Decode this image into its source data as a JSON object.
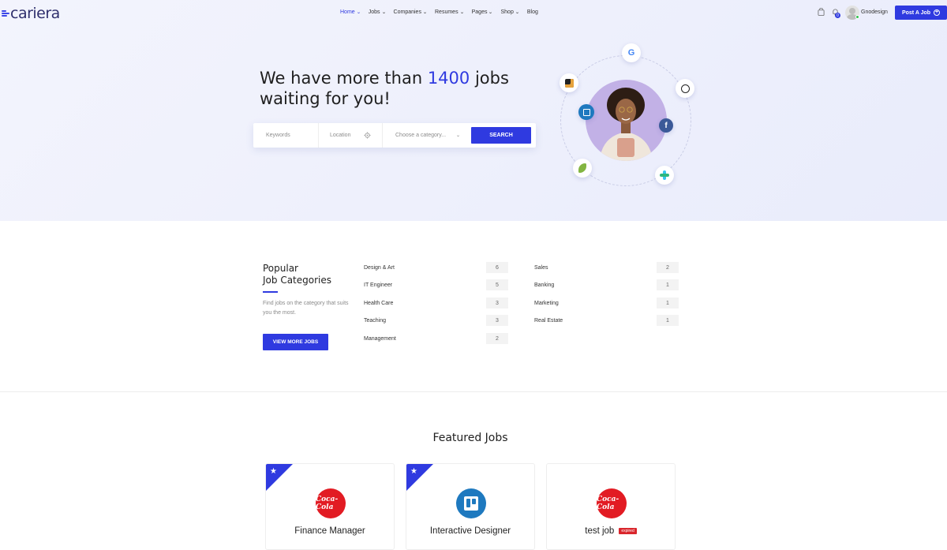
{
  "header": {
    "logo": "cariera",
    "nav": [
      {
        "label": "Home",
        "dropdown": true,
        "active": true
      },
      {
        "label": "Jobs",
        "dropdown": true
      },
      {
        "label": "Companies",
        "dropdown": true
      },
      {
        "label": "Resumes",
        "dropdown": true
      },
      {
        "label": "Pages",
        "dropdown": true
      },
      {
        "label": "Shop",
        "dropdown": true
      },
      {
        "label": "Blog",
        "dropdown": false
      }
    ],
    "notification_count": "0",
    "username": "Gnodesign",
    "post_job_label": "Post A Job"
  },
  "hero": {
    "title_prefix": "We have more than",
    "title_number": "1400",
    "title_suffix": "jobs",
    "title_line2": "waiting for you!",
    "keywords_placeholder": "Keywords",
    "location_placeholder": "Location",
    "category_placeholder": "Choose a category...",
    "search_label": "SEARCH",
    "company_badges": [
      "google-icon",
      "squarespace-icon",
      "github-icon",
      "trello-icon",
      "facebook-icon",
      "envato-icon",
      "slack-icon"
    ]
  },
  "categories": {
    "title_line1": "Popular",
    "title_line2": "Job Categories",
    "description": "Find jobs on the category that suits you the most.",
    "view_more_label": "VIEW MORE JOBS",
    "left": [
      {
        "name": "Design & Art",
        "count": "6"
      },
      {
        "name": "IT Engineer",
        "count": "5"
      },
      {
        "name": "Health Care",
        "count": "3"
      },
      {
        "name": "Teaching",
        "count": "3"
      },
      {
        "name": "Management",
        "count": "2"
      }
    ],
    "right": [
      {
        "name": "Sales",
        "count": "2"
      },
      {
        "name": "Banking",
        "count": "1"
      },
      {
        "name": "Marketing",
        "count": "1"
      },
      {
        "name": "Real Estate",
        "count": "1"
      }
    ]
  },
  "featured": {
    "title": "Featured Jobs",
    "jobs": [
      {
        "title": "Finance Manager",
        "logo": "coca-cola-logo",
        "logo_text": "Coca-Cola",
        "featured": true,
        "expired": false
      },
      {
        "title": "Interactive Designer",
        "logo": "trello-logo",
        "logo_text": "",
        "featured": true,
        "expired": false
      },
      {
        "title": "test job",
        "logo": "coca-cola-logo",
        "logo_text": "Coca-Cola",
        "featured": false,
        "expired": true,
        "expired_label": "expired"
      }
    ]
  },
  "colors": {
    "accent": "#2f3ae0",
    "hero_bg": "#eef0fc",
    "expired": "#d9262c"
  }
}
